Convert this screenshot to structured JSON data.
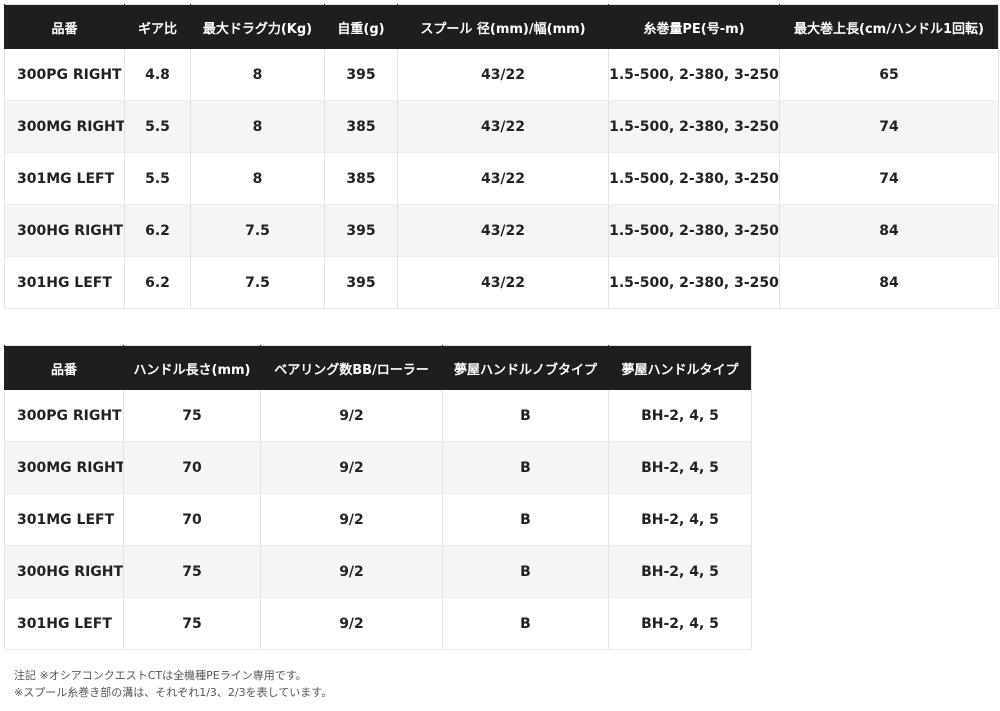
{
  "spec_table": {
    "headers": [
      "品番",
      "ギア比",
      "最大ドラグ力(Kg)",
      "自重(g)",
      "スプール 径(mm)/幅(mm)",
      "糸巻量PE(号-m)",
      "最大巻上長(cm/ハンドル1回転)"
    ],
    "rows": [
      [
        "300PG RIGHT",
        "4.8",
        "8",
        "395",
        "43/22",
        "1.5-500, 2-380, 3-250",
        "65"
      ],
      [
        "300MG RIGHT",
        "5.5",
        "8",
        "385",
        "43/22",
        "1.5-500, 2-380, 3-250",
        "74"
      ],
      [
        "301MG LEFT",
        "5.5",
        "8",
        "385",
        "43/22",
        "1.5-500, 2-380, 3-250",
        "74"
      ],
      [
        "300HG RIGHT",
        "6.2",
        "7.5",
        "395",
        "43/22",
        "1.5-500, 2-380, 3-250",
        "84"
      ],
      [
        "301HG LEFT",
        "6.2",
        "7.5",
        "395",
        "43/22",
        "1.5-500, 2-380, 3-250",
        "84"
      ]
    ]
  },
  "handle_table": {
    "headers": [
      "品番",
      "ハンドル長さ(mm)",
      "ベアリング数BB/ローラー",
      "夢屋ハンドルノブタイプ",
      "夢屋ハンドルタイプ"
    ],
    "rows": [
      [
        "300PG RIGHT",
        "75",
        "9/2",
        "B",
        "BH-2, 4, 5"
      ],
      [
        "300MG RIGHT",
        "70",
        "9/2",
        "B",
        "BH-2, 4, 5"
      ],
      [
        "301MG LEFT",
        "70",
        "9/2",
        "B",
        "BH-2, 4, 5"
      ],
      [
        "300HG RIGHT",
        "75",
        "9/2",
        "B",
        "BH-2, 4, 5"
      ],
      [
        "301HG LEFT",
        "75",
        "9/2",
        "B",
        "BH-2, 4, 5"
      ]
    ]
  },
  "notes": {
    "line1": "注記 ※オシアコンクエストCTは全機種PEライン専用です。",
    "line2": "※スプール糸巻き部の溝は、それぞれ1/3、2/3を表しています。"
  }
}
